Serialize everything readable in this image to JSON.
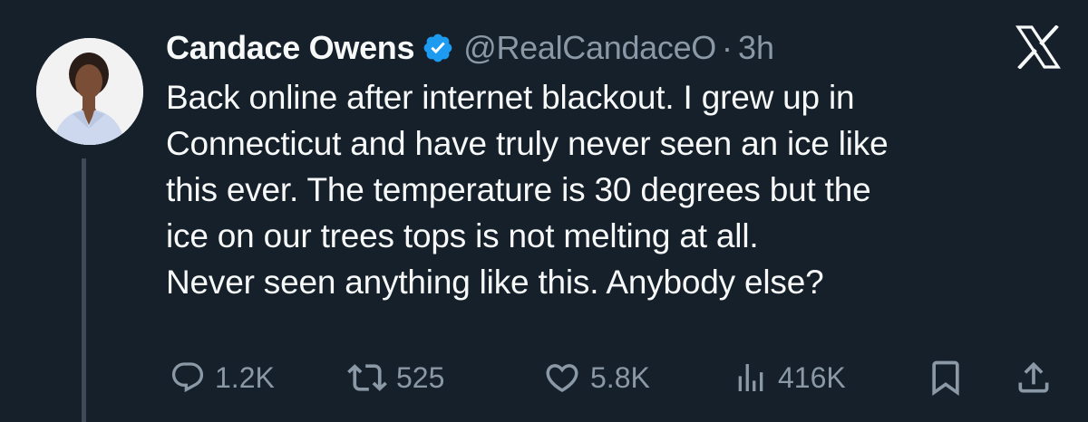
{
  "author": {
    "name": "Candace Owens",
    "handle": "@RealCandaceO",
    "separator": "·",
    "time": "3h",
    "verified": true,
    "verified_color": "#1d9bf0"
  },
  "tweet": {
    "lines": [
      "Back online after internet blackout. I grew up in",
      "Connecticut and have truly never seen an ice like",
      "this ever. The temperature is 30 degrees but the",
      "ice on our trees tops is not melting at all.",
      "Never seen anything like this. Anybody else?"
    ]
  },
  "actions": {
    "replies": "1.2K",
    "reposts": "525",
    "likes": "5.8K",
    "views": "416K"
  },
  "icons": {
    "brand": "x-logo-icon",
    "reply": "reply-icon",
    "repost": "repost-icon",
    "like": "heart-icon",
    "views": "views-icon",
    "bookmark": "bookmark-icon",
    "share": "share-icon"
  },
  "colors": {
    "background": "#15202b",
    "text": "#f7f9f9",
    "muted": "#8b98a5",
    "thread_line": "#3e4a55"
  }
}
